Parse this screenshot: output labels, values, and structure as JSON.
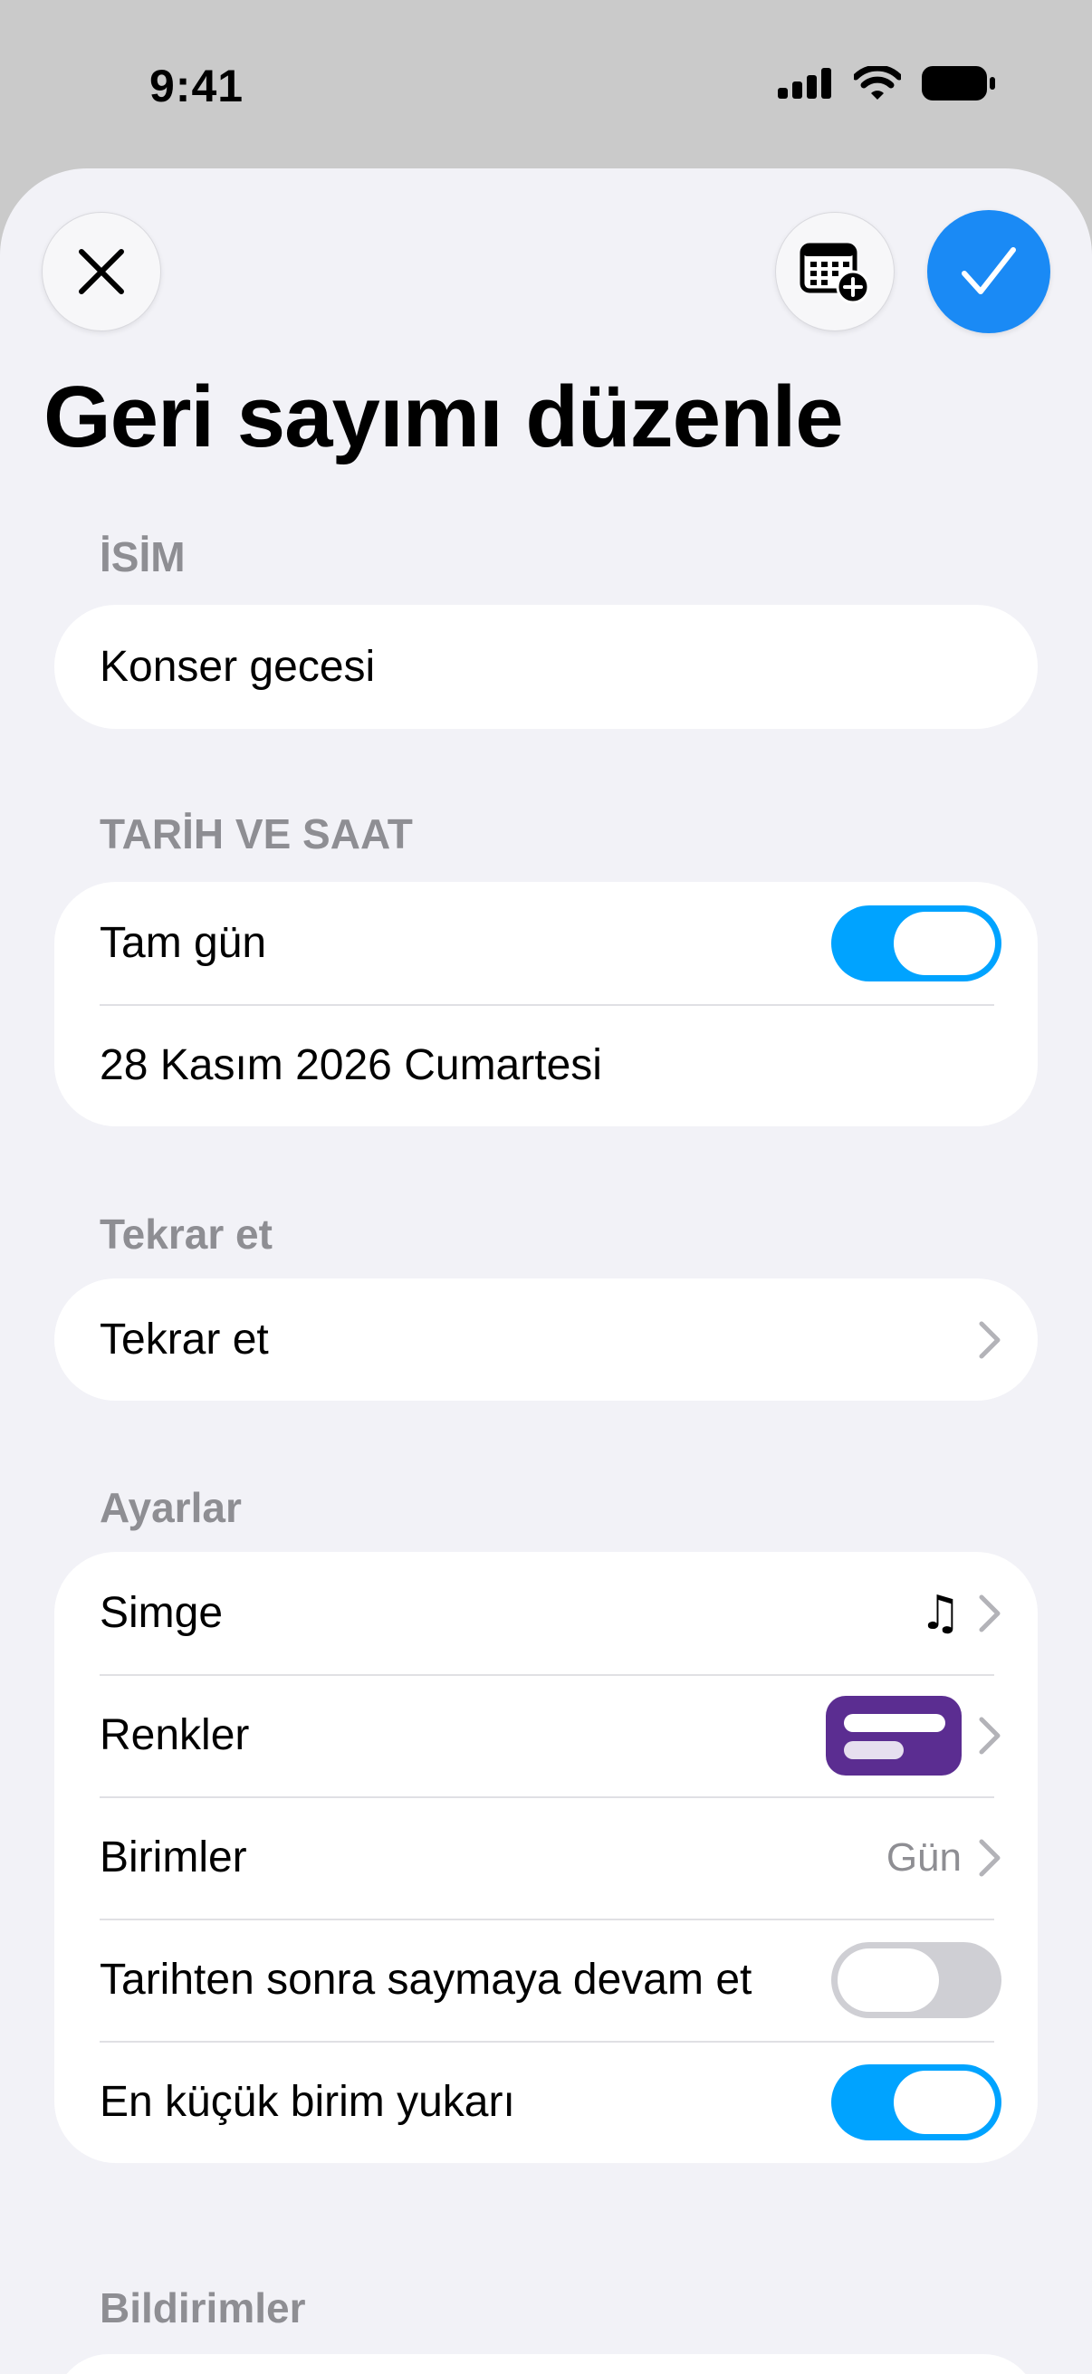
{
  "status_bar": {
    "time": "9:41"
  },
  "header": {
    "title": "Geri sayımı düzenle"
  },
  "name_section": {
    "label": "İSİM",
    "value": "Konser gecesi"
  },
  "datetime_section": {
    "label": "TARİH VE SAAT",
    "all_day_label": "Tam gün",
    "all_day_on": true,
    "date_value": "28 Kasım 2026 Cumartesi"
  },
  "repeat_section": {
    "label": "Tekrar et",
    "row_label": "Tekrar et"
  },
  "settings_section": {
    "label": "Ayarlar",
    "icon_label": "Simge",
    "icon_value": "♫",
    "colors_label": "Renkler",
    "color_value": "#5b2d91",
    "units_label": "Birimler",
    "units_value": "Gün",
    "continue_label": "Tarihten sonra saymaya devam et",
    "continue_on": false,
    "round_up_label": "En küçük birim yukarı",
    "round_up_on": true
  },
  "notifications_section": {
    "label": "Bildirimler"
  },
  "colors": {
    "accent": "#1a8af5",
    "toggle_on": "#00a3ff",
    "toggle_off": "#cfcfd4"
  }
}
